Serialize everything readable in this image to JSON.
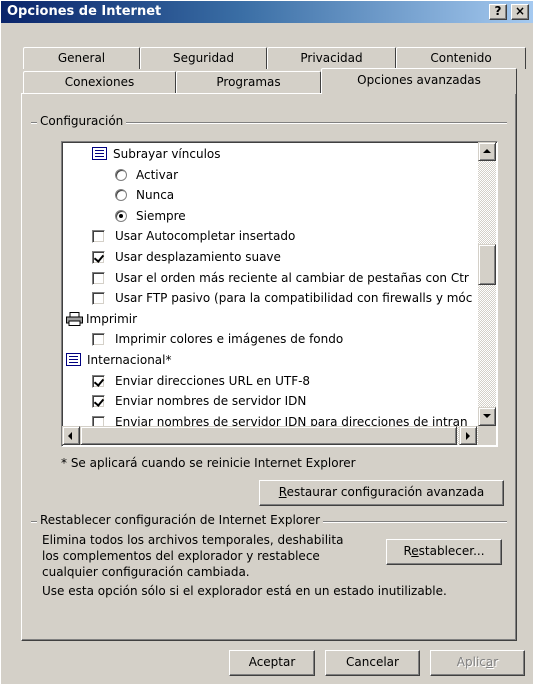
{
  "window": {
    "title": "Opciones de Internet",
    "help_button": "?",
    "close_button": "×"
  },
  "tabs_back": [
    "General",
    "Seguridad",
    "Privacidad",
    "Contenido"
  ],
  "tabs_front": [
    "Conexiones",
    "Programas",
    "Opciones avanzadas"
  ],
  "active_tab": "Opciones avanzadas",
  "settings": {
    "group_label": "Configuración",
    "items": [
      {
        "type": "category",
        "icon": "list-icon",
        "label": "Subrayar vínculos"
      },
      {
        "type": "radio",
        "checked": false,
        "label": "Activar"
      },
      {
        "type": "radio",
        "checked": false,
        "label": "Nunca"
      },
      {
        "type": "radio",
        "checked": true,
        "label": "Siempre"
      },
      {
        "type": "checkbox",
        "checked": false,
        "label": "Usar Autocompletar insertado"
      },
      {
        "type": "checkbox",
        "checked": true,
        "label": "Usar desplazamiento suave"
      },
      {
        "type": "checkbox",
        "checked": false,
        "label": "Usar el orden más reciente al cambiar de pestañas con Ctr"
      },
      {
        "type": "checkbox",
        "checked": false,
        "label": "Usar FTP pasivo (para la compatibilidad con firewalls y móc"
      },
      {
        "type": "category",
        "icon": "printer-icon",
        "label": "Imprimir"
      },
      {
        "type": "checkbox",
        "checked": false,
        "label": "Imprimir colores e imágenes de fondo"
      },
      {
        "type": "category",
        "icon": "list-icon",
        "label": "Internacional*"
      },
      {
        "type": "checkbox",
        "checked": true,
        "label": "Enviar direcciones URL en UTF-8"
      },
      {
        "type": "checkbox",
        "checked": true,
        "label": "Enviar nombres de servidor IDN"
      },
      {
        "type": "checkbox",
        "checked": false,
        "label": "Enviar nombres de servidor IDN para direcciones de intran"
      }
    ],
    "note": "* Se aplicará cuando se reinicie Internet Explorer",
    "restore_button_underlined": "R",
    "restore_button_rest": "estaurar configuración avanzada"
  },
  "reset": {
    "group_label": "Restablecer configuración de Internet Explorer",
    "description_lines": [
      "Elimina todos los archivos temporales, deshabilita",
      "los complementos del explorador y restablece",
      "cualquier configuración cambiada."
    ],
    "warning": "Use esta opción sólo si el explorador está en un estado inutilizable.",
    "button_pre": "R",
    "button_underlined": "e",
    "button_post": "stablecer..."
  },
  "footer": {
    "ok": "Aceptar",
    "cancel": "Cancelar",
    "apply_pre": "Aplic",
    "apply_underlined": "a",
    "apply_post": "r"
  }
}
